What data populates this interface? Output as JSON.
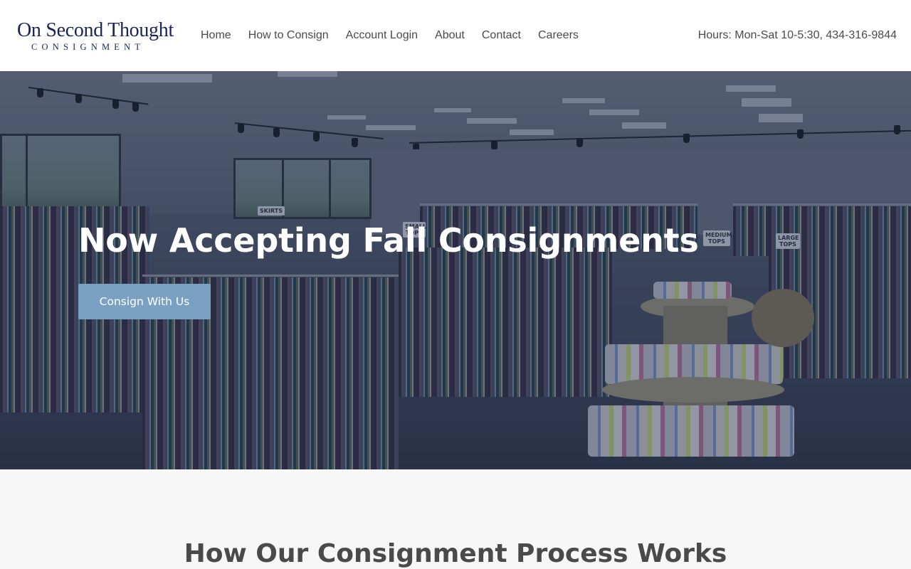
{
  "header": {
    "logo_main": "On Second Thought",
    "logo_sub": "CONSIGNMENT",
    "nav": [
      "Home",
      "How to Consign",
      "Account Login",
      "About",
      "Contact",
      "Careers"
    ],
    "hours": "Hours: Mon-Sat 10-5:30, 434-316-9844"
  },
  "hero": {
    "title": "Now Accepting Fall Consignments",
    "button_label": "Consign With Us",
    "signs": {
      "skirts": "SKIRTS",
      "small": "SMALL TOPS",
      "medium": "MEDIUM TOPS",
      "large": "LARGE TOPS"
    }
  },
  "process": {
    "title": "How Our Consignment Process Works"
  },
  "colors": {
    "brand_navy": "#1b2456",
    "button": "#7aa0c2",
    "nav_text": "#4a4a4a",
    "section_bg": "#f7f7f7"
  }
}
